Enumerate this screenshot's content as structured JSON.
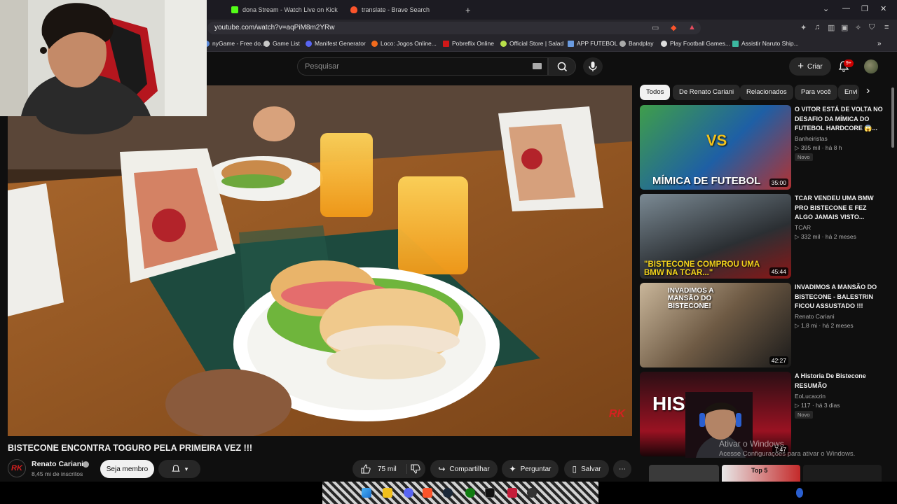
{
  "browser": {
    "tabs": [
      {
        "label": "dona Stream - Watch Live on Kick",
        "favicon_color": "#53fc18"
      },
      {
        "label": "translate - Brave Search",
        "favicon_color": "#fb542b"
      }
    ],
    "new_tab_label": "+",
    "url": "youtube.com/watch?v=aqPiM8m2YRw",
    "window_controls": [
      "⌄",
      "—",
      "❐",
      "✕"
    ],
    "bookmarks": [
      {
        "label": "nyGame - Free do...",
        "icon": "globe-icon"
      },
      {
        "label": "Game List",
        "icon": "globe-icon"
      },
      {
        "label": "Manifest Generator",
        "icon": "discord-icon"
      },
      {
        "label": "Loco: Jogos Online...",
        "icon": "loco-icon"
      },
      {
        "label": "Pobreflix Online",
        "icon": "pobreflix-icon"
      },
      {
        "label": "Official Store | Salad",
        "icon": "salad-icon"
      },
      {
        "label": "APP FUTEBOL",
        "icon": "app-icon"
      },
      {
        "label": "Bandplay",
        "icon": "bandplay-icon"
      },
      {
        "label": "Play Football Games...",
        "icon": "football-icon"
      },
      {
        "label": "Assistir Naruto Ship...",
        "icon": "naruto-icon"
      }
    ],
    "bookmarks_overflow": "»"
  },
  "youtube": {
    "search_placeholder": "Pesquisar",
    "create_label": "Criar",
    "notification_count": "9+",
    "video_title": "BISTECONE ENCONTRA TOGURO PELA PRIMEIRA VEZ !!!",
    "channel": {
      "name": "Renato Cariani",
      "subscribers": "8,45 mi de inscritos",
      "avatar_text": "RK"
    },
    "join_label": "Seja membro",
    "like_count": "75 mil",
    "share_label": "Compartilhar",
    "ask_label": "Perguntar",
    "save_label": "Salvar",
    "more_label": "⋯",
    "player_watermark": "RK",
    "chips": [
      "Todos",
      "De Renato Cariani",
      "Relacionados",
      "Para você",
      "Envi"
    ],
    "chips_next": "›",
    "recommendations": [
      {
        "title": "O VITOR ESTÁ DE VOLTA NO DESAFIO DA MÍMICA DO FUTEBOL HARDCORE 😱...",
        "channel": "Banheiristas",
        "views": "395 mil",
        "age": "há 8 h",
        "badge": "Novo",
        "duration": "35:00",
        "thumb_text": "MÍMICA DE FUTEBOL",
        "thumb_sub": "VS"
      },
      {
        "title": "TCAR VENDEU UMA BMW PRO BISTECONE E FEZ ALGO JAMAIS VISTO...",
        "channel": "TCAR",
        "views": "332 mil",
        "age": "há 2 meses",
        "duration": "45:44",
        "thumb_text": "\"BISTECONE COMPROU UMA BMW NA TCAR...\""
      },
      {
        "title": "INVADIMOS A MANSÃO DO BISTECONE - BALESTRIN FICOU ASSUSTADO !!!",
        "channel": "Renato Cariani",
        "views": "1,8 mi",
        "age": "há 2 meses",
        "duration": "42:27",
        "thumb_text": "INVADIMOS A MANSÃO DO BISTECONE!"
      },
      {
        "title": "A Historia De Bistecone RESUMÃO",
        "channel": "EoLucaxzin",
        "views": "117",
        "age": "há 3 dias",
        "badge": "Novo",
        "duration": "7:47",
        "thumb_text": "HISTÓRIA"
      }
    ],
    "next_thumb_text": "Top 5"
  },
  "overlays": {
    "activate_title": "Ativar o Windows",
    "activate_sub": "Acesse Configurações para ativar o Windows."
  },
  "colors": {
    "background": "#0f0f0f",
    "surface": "#272727",
    "text": "#f1f1f1",
    "secondary_text": "#aaaaaa",
    "accent_red": "#cc0000"
  }
}
